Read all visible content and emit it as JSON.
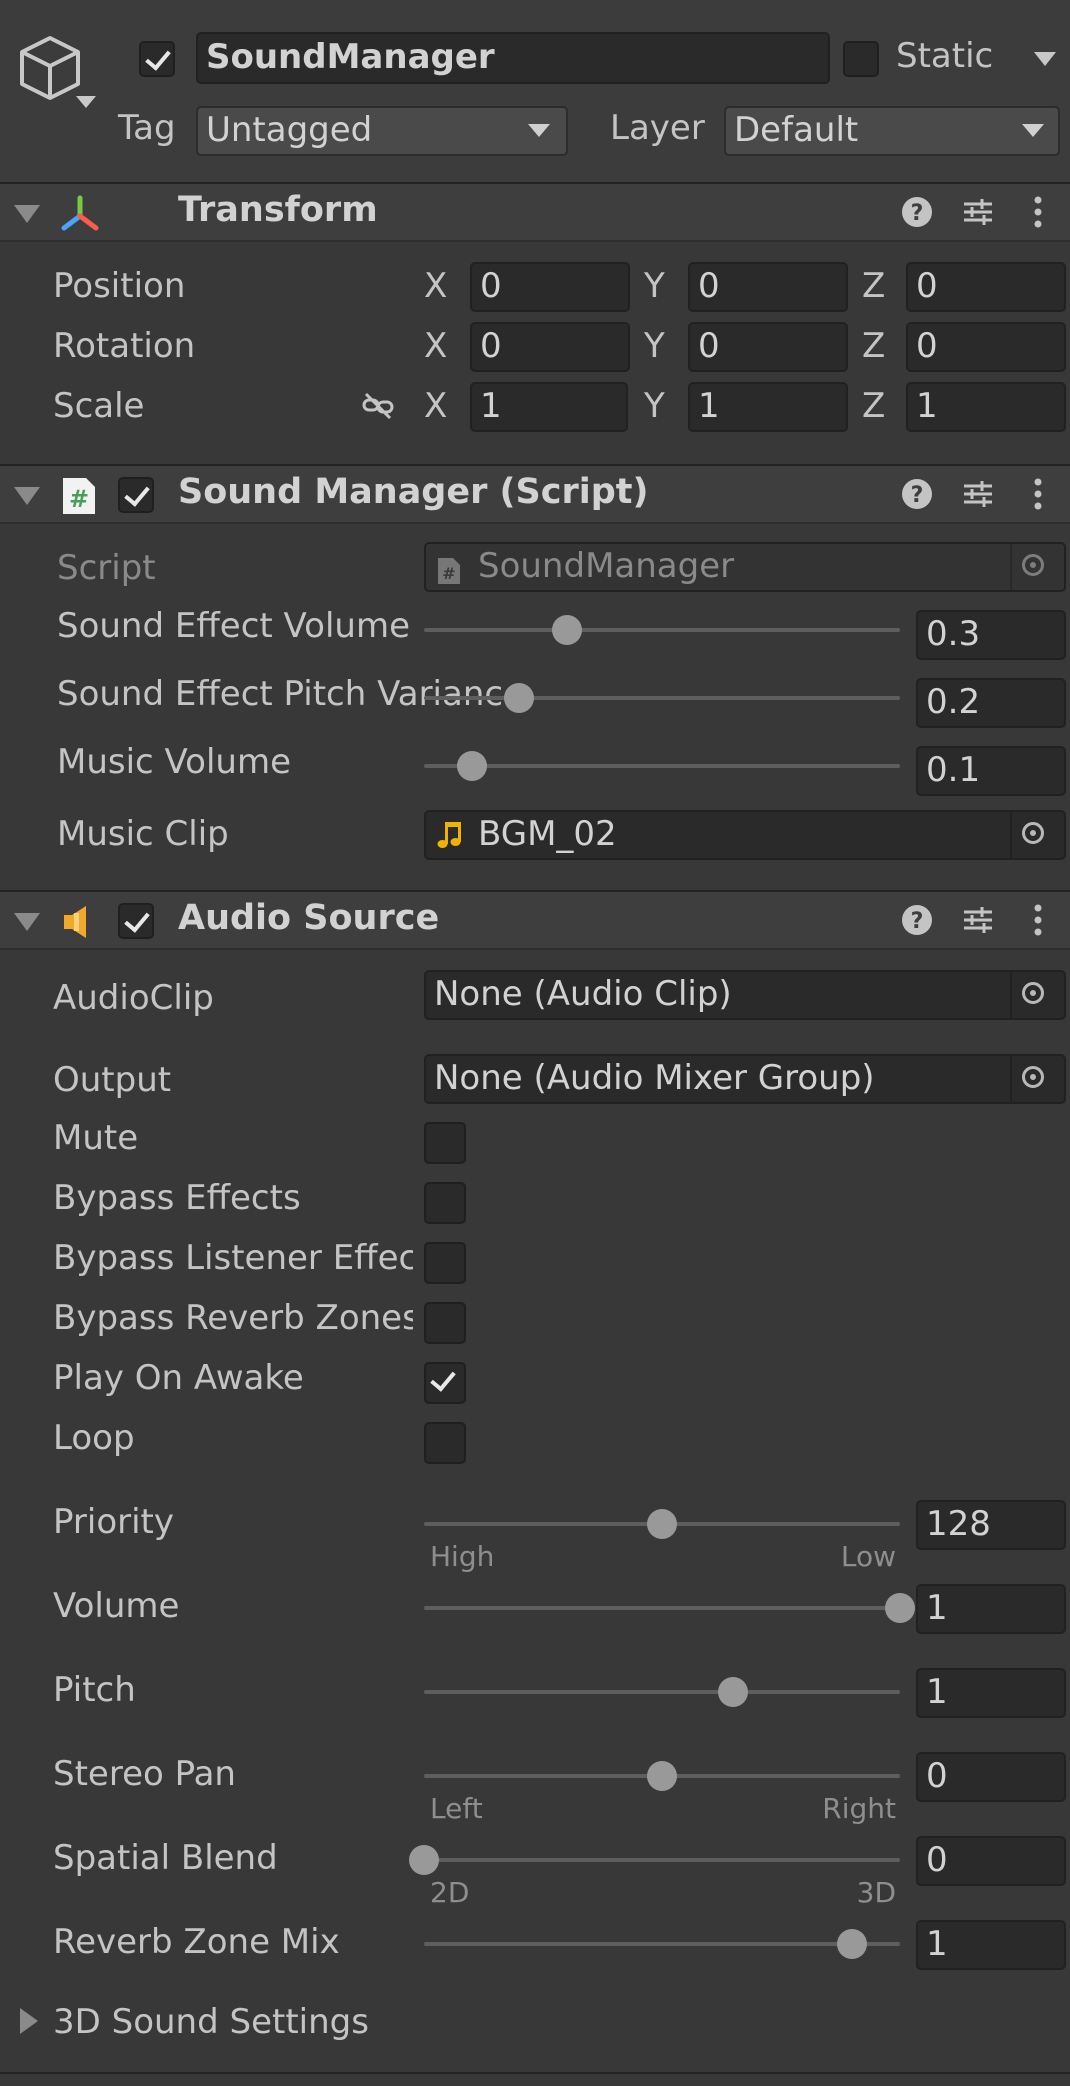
{
  "header": {
    "object_name": "SoundManager",
    "active": true,
    "static_label": "Static",
    "static_checked": false,
    "tag_label": "Tag",
    "tag_value": "Untagged",
    "layer_label": "Layer",
    "layer_value": "Default"
  },
  "transform": {
    "title": "Transform",
    "rows": [
      {
        "label": "Position",
        "x": "0",
        "y": "0",
        "z": "0"
      },
      {
        "label": "Rotation",
        "x": "0",
        "y": "0",
        "z": "0"
      },
      {
        "label": "Scale",
        "x": "1",
        "y": "1",
        "z": "1"
      }
    ],
    "axis_labels": [
      "X",
      "Y",
      "Z"
    ]
  },
  "sound_manager": {
    "title": "Sound Manager (Script)",
    "enabled": true,
    "script_label": "Script",
    "script_value": "SoundManager",
    "fields": [
      {
        "label": "Sound Effect Volume",
        "value": "0.3",
        "fraction": 0.3
      },
      {
        "label": "Sound Effect Pitch Variance",
        "value": "0.2",
        "fraction": 0.2
      },
      {
        "label": "Music Volume",
        "value": "0.1",
        "fraction": 0.1
      }
    ],
    "music_clip_label": "Music Clip",
    "music_clip_value": "BGM_02"
  },
  "audio_source": {
    "title": "Audio Source",
    "enabled": true,
    "audioclip_label": "AudioClip",
    "audioclip_value": "None (Audio Clip)",
    "output_label": "Output",
    "output_value": "None (Audio Mixer Group)",
    "toggles": [
      {
        "label": "Mute",
        "checked": false
      },
      {
        "label": "Bypass Effects",
        "checked": false
      },
      {
        "label": "Bypass Listener Effects",
        "checked": false
      },
      {
        "label": "Bypass Reverb Zones",
        "checked": false
      },
      {
        "label": "Play On Awake",
        "checked": true
      },
      {
        "label": "Loop",
        "checked": false
      }
    ],
    "sliders": [
      {
        "label": "Priority",
        "value": "128",
        "fraction": 0.5,
        "min_label": "High",
        "max_label": "Low"
      },
      {
        "label": "Volume",
        "value": "1",
        "fraction": 1.0
      },
      {
        "label": "Pitch",
        "value": "1",
        "fraction": 0.65
      },
      {
        "label": "Stereo Pan",
        "value": "0",
        "fraction": 0.5,
        "min_label": "Left",
        "max_label": "Right"
      },
      {
        "label": "Spatial Blend",
        "value": "0",
        "fraction": 0.0,
        "min_label": "2D",
        "max_label": "3D"
      },
      {
        "label": "Reverb Zone Mix",
        "value": "1",
        "fraction": 0.9
      }
    ],
    "sound_settings_label": "3D Sound Settings"
  },
  "colors": {
    "background": "#383838",
    "header": "#3e3e3e",
    "field": "#2a2a2a",
    "audio_icon": "#f0a92a",
    "music_note": "#f0b400",
    "script_icon": "#5fa36a"
  }
}
